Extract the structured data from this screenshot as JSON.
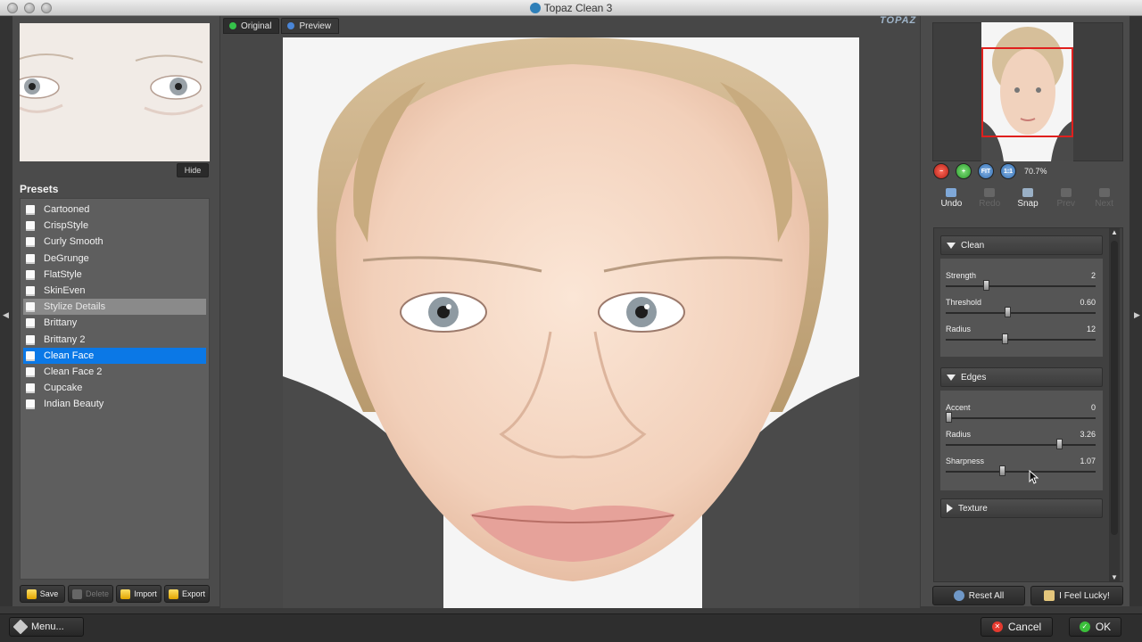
{
  "window": {
    "title": "Topaz Clean 3"
  },
  "detail_preview": {
    "hide_label": "Hide"
  },
  "presets": {
    "title": "Presets",
    "items": [
      {
        "label": "Cartooned",
        "state": "normal"
      },
      {
        "label": "CrispStyle",
        "state": "normal"
      },
      {
        "label": "Curly Smooth",
        "state": "normal"
      },
      {
        "label": "DeGrunge",
        "state": "normal"
      },
      {
        "label": "FlatStyle",
        "state": "normal"
      },
      {
        "label": "SkinEven",
        "state": "normal"
      },
      {
        "label": "Stylize Details",
        "state": "dim"
      },
      {
        "label": "Brittany",
        "state": "normal"
      },
      {
        "label": "Brittany 2",
        "state": "normal"
      },
      {
        "label": "Clean Face",
        "state": "selected"
      },
      {
        "label": "Clean Face 2",
        "state": "normal"
      },
      {
        "label": "Cupcake",
        "state": "normal"
      },
      {
        "label": "Indian Beauty",
        "state": "normal"
      }
    ],
    "buttons": {
      "save": "Save",
      "delete": "Delete",
      "import": "Import",
      "export": "Export"
    }
  },
  "view_tabs": {
    "original": "Original",
    "preview": "Preview"
  },
  "logo_text": "TOPAZ",
  "zoom": {
    "minus": "−",
    "plus": "+",
    "fit": "FIT",
    "one_to_one": "1:1",
    "level": "70.7%"
  },
  "actions": {
    "undo": "Undo",
    "redo": "Redo",
    "snap": "Snap",
    "prev": "Prev",
    "next": "Next"
  },
  "sections": {
    "clean": {
      "title": "Clean",
      "sliders": [
        {
          "label": "Strength",
          "value": "2",
          "fraction": 0.26
        },
        {
          "label": "Threshold",
          "value": "0.60",
          "fraction": 0.41
        },
        {
          "label": "Radius",
          "value": "12",
          "fraction": 0.39
        }
      ]
    },
    "edges": {
      "title": "Edges",
      "sliders": [
        {
          "label": "Accent",
          "value": "0",
          "fraction": 0.0
        },
        {
          "label": "Radius",
          "value": "3.26",
          "fraction": 0.77
        },
        {
          "label": "Sharpness",
          "value": "1.07",
          "fraction": 0.37
        }
      ]
    },
    "texture": {
      "title": "Texture"
    }
  },
  "footer": {
    "reset_all": "Reset All",
    "feel_lucky": "I Feel Lucky!"
  },
  "bottom": {
    "menu": "Menu...",
    "cancel": "Cancel",
    "ok": "OK"
  },
  "colors": {
    "selection": "#0b78e6",
    "cancel_icon": "#e53a2f",
    "ok_icon": "#3bbf3b"
  }
}
